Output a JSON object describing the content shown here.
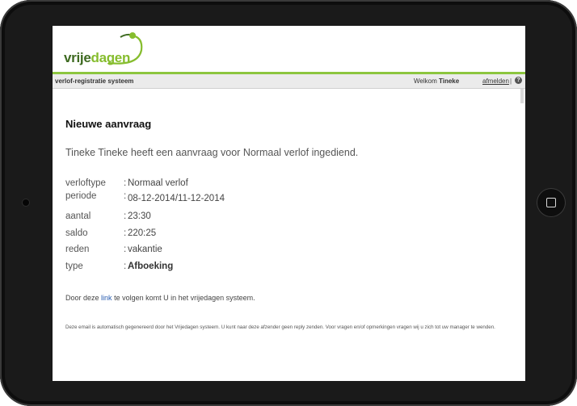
{
  "logo": {
    "part1": "vrije",
    "part2": "dagen"
  },
  "topbar": {
    "system_label": "verlof-registratie systeem",
    "welcome_prefix": "Welkom",
    "user_name": "Tineke",
    "logout_label": "afmelden",
    "separator": "|",
    "help_symbol": "?"
  },
  "email": {
    "title": "Nieuwe aanvraag",
    "intro": "Tineke Tineke heeft een aanvraag voor Normaal verlof ingediend.",
    "details": [
      {
        "label": "verloftype",
        "value": "Normaal verlof"
      },
      {
        "label": "periode",
        "value": "08-12-2014/11-12-2014"
      },
      {
        "label": "aantal",
        "value": "23:30"
      },
      {
        "label": "saldo",
        "value": "220:25"
      },
      {
        "label": "reden",
        "value": "vakantie"
      },
      {
        "label": "type",
        "value": "Afboeking"
      }
    ],
    "colon": ":",
    "link_prefix": "Door deze",
    "link_text": "link",
    "link_suffix": "te volgen komt U in het vrijedagen systeem.",
    "disclaimer": "Deze email is automatisch gegenereerd door het Vrijedagen systeem. U kunt naar deze afzender geen reply zenden. Voor vragen en/of opmerkingen vragen wij u zich tot uw manager te wenden."
  },
  "colors": {
    "brand_green": "#8cc63f",
    "brand_dark_green": "#3e6a21",
    "link_blue": "#2a5db0"
  },
  "icons": {
    "help": "help-icon",
    "home": "home-button-icon"
  }
}
